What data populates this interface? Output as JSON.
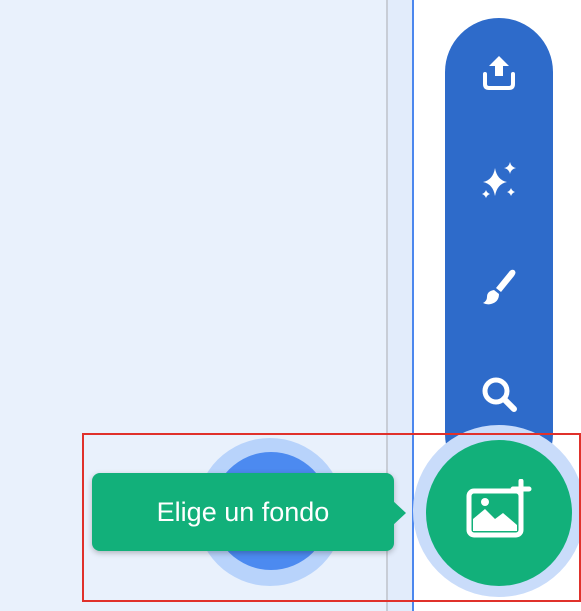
{
  "tooltip": {
    "text": "Elige un fondo"
  },
  "menu": {
    "items": [
      {
        "icon": "upload-icon"
      },
      {
        "icon": "surprise-sparkle-icon"
      },
      {
        "icon": "paint-brush-icon"
      },
      {
        "icon": "search-icon"
      }
    ]
  },
  "main_button": {
    "icon": "add-backdrop-image-icon"
  },
  "colors": {
    "menu_background": "#2e6bca",
    "main_button": "#12b07a",
    "tooltip_background": "#12b07a",
    "highlight_border": "#e0312b",
    "panel_background": "#e9f1fc"
  }
}
